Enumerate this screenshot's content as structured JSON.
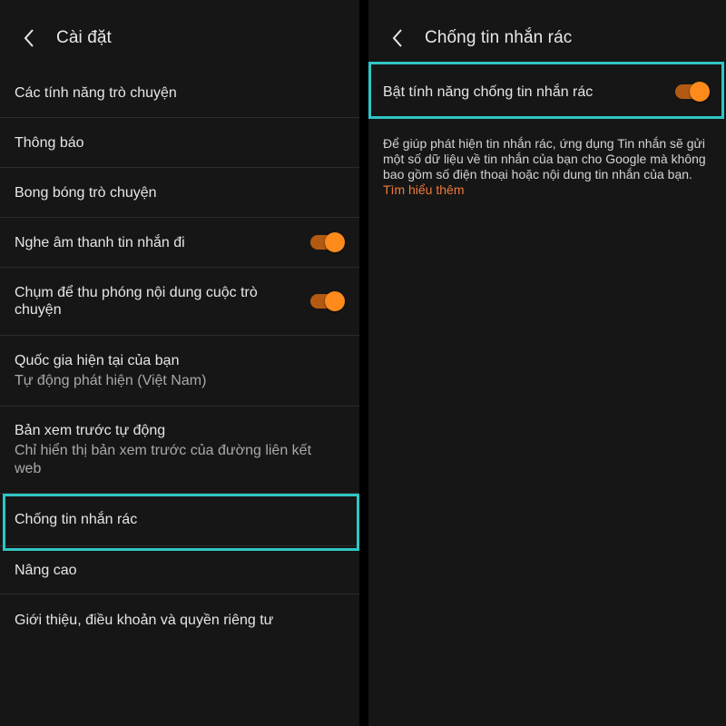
{
  "left_screen": {
    "title": "Cài đặt",
    "items": [
      {
        "label": "Các tính năng trò chuyện"
      },
      {
        "label": "Thông báo"
      },
      {
        "label": "Bong bóng trò chuyện"
      },
      {
        "label": "Nghe âm thanh tin nhắn đi",
        "toggle_on": true
      },
      {
        "label": "Chụm để thu phóng nội dung cuộc trò chuyện",
        "toggle_on": true
      },
      {
        "label": "Quốc gia hiện tại của bạn",
        "sub": "Tự động phát hiện (Việt Nam)"
      },
      {
        "label": "Bản xem trước tự động",
        "sub": "Chỉ hiển thị bản xem trước của đường liên kết web"
      },
      {
        "label": "Chống tin nhắn rác",
        "highlighted": true
      },
      {
        "label": "Nâng cao"
      },
      {
        "label": "Giới thiệu, điều khoản và quyền riêng tư"
      }
    ]
  },
  "right_screen": {
    "title": "Chống tin nhắn rác",
    "toggle_item": {
      "label": "Bật tính năng chống tin nhắn rác",
      "toggle_on": true,
      "highlighted": true
    },
    "description": "Để giúp phát hiện tin nhắn rác, ứng dụng Tin nhắn sẽ gửi một số dữ liệu về tin nhắn của bạn cho Google mà không bao gồm số điện thoại hoặc nội dung tin nhắn của bạn.",
    "learn_more": "Tìm hiểu thêm"
  },
  "colors": {
    "toggle_on": "#ff8a1c",
    "highlight_outline": "#2fc6c6",
    "link": "#f07a3a"
  },
  "icons": {
    "back": "chevron-left-icon"
  }
}
